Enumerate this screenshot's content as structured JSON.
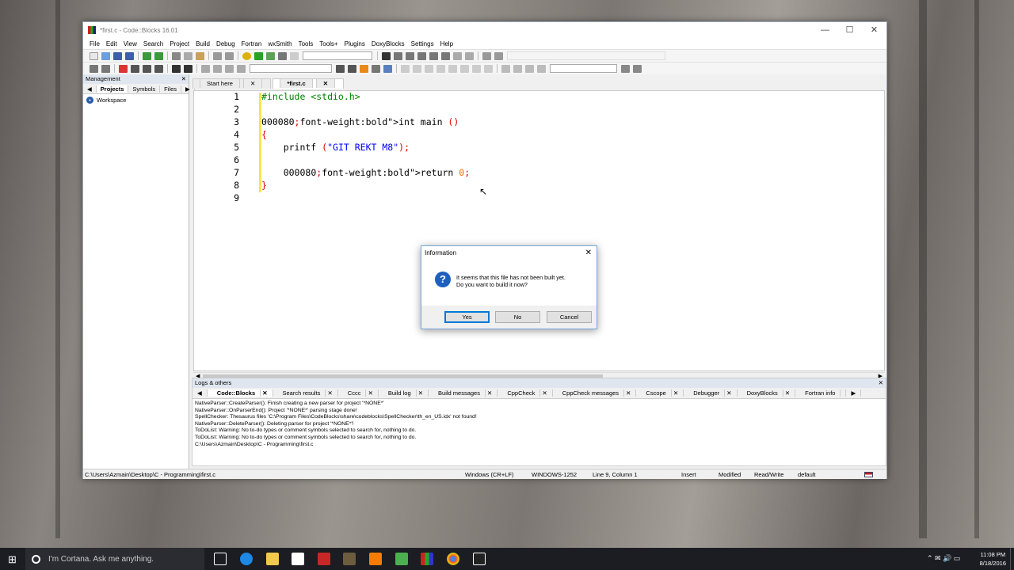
{
  "window": {
    "title": "*first.c - Code::Blocks 16.01"
  },
  "menu": [
    "File",
    "Edit",
    "View",
    "Search",
    "Project",
    "Build",
    "Debug",
    "Fortran",
    "wxSmith",
    "Tools",
    "Tools+",
    "Plugins",
    "DoxyBlocks",
    "Settings",
    "Help"
  ],
  "management": {
    "title": "Management",
    "tabs": [
      "Projects",
      "Symbols",
      "Files"
    ],
    "workspace": "Workspace"
  },
  "editor": {
    "tabs": [
      "Start here",
      "*first.c"
    ],
    "lines": [
      {
        "n": "1",
        "code": "#include <stdio.h>"
      },
      {
        "n": "2",
        "code": ""
      },
      {
        "n": "3",
        "code": "int main ()"
      },
      {
        "n": "4",
        "code": "{"
      },
      {
        "n": "5",
        "code": "    printf (\"GIT REKT M8\");"
      },
      {
        "n": "6",
        "code": ""
      },
      {
        "n": "7",
        "code": "    return 0;"
      },
      {
        "n": "8",
        "code": "}"
      },
      {
        "n": "9",
        "code": ""
      }
    ]
  },
  "logs": {
    "title": "Logs & others",
    "tabs": [
      "Code::Blocks",
      "Search results",
      "Cccc",
      "Build log",
      "Build messages",
      "CppCheck",
      "CppCheck messages",
      "Cscope",
      "Debugger",
      "DoxyBlocks",
      "Fortran info"
    ],
    "lines": [
      "NativeParser::CreateParser(): Finish creating a new parser for project '*NONE*'",
      "NativeParser::OnParserEnd(): Project '*NONE*' parsing stage done!",
      "SpellChecker: Thesaurus files 'C:\\Program Files\\CodeBlocks\\share\\codeblocks\\SpellChecker\\th_en_US.idx' not found!",
      "NativeParser::DeleteParser(): Deleting parser for project '*NONE*'!",
      "ToDoList: Warning: No to-do types or comment symbols selected to search for, nothing to do.",
      "ToDoList: Warning: No to-do types or comment symbols selected to search for, nothing to do.",
      "C:\\Users\\Azmain\\Desktop\\C - Programming\\first.c"
    ]
  },
  "status": {
    "path": "C:\\Users\\Azmain\\Desktop\\C - Programming\\first.c",
    "eol": "Windows (CR+LF)",
    "encoding": "WINDOWS-1252",
    "position": "Line 9, Column 1",
    "mode": "Insert",
    "modified": "Modified",
    "rw": "Read/Write",
    "profile": "default"
  },
  "dialog": {
    "title": "Information",
    "line1": "It seems that this file has not been built yet.",
    "line2": "Do you want to build it now?",
    "yes": "Yes",
    "no": "No",
    "cancel": "Cancel"
  },
  "taskbar": {
    "search": "I'm Cortana. Ask me anything.",
    "time": "11:08 PM",
    "date": "8/18/2016"
  },
  "colors": {
    "keyword": "#000080",
    "string": "#0000ff",
    "number": "#f07000",
    "preproc": "#008000"
  }
}
